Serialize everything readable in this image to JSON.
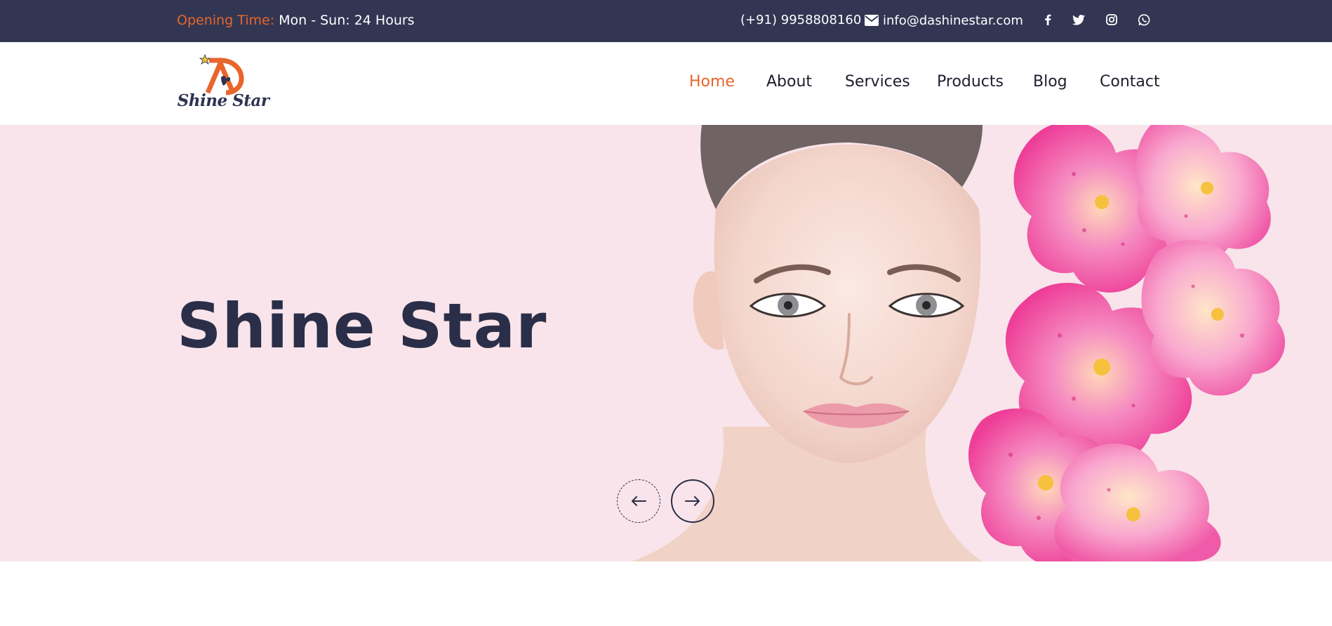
{
  "topbar": {
    "opening_label": "Opening Time:",
    "opening_value": "Mon - Sun: 24 Hours",
    "phone": "(+91) 9958808160",
    "email": "info@dashinestar.com",
    "icons": [
      "envelope-icon",
      "facebook-icon",
      "twitter-icon",
      "instagram-icon",
      "whatsapp-icon"
    ]
  },
  "header": {
    "logo_text": "Shine Star",
    "nav": [
      "Home",
      "About",
      "Services",
      "Products",
      "Blog",
      "Contact"
    ],
    "active_nav": "Home"
  },
  "hero": {
    "title": "Shine Star",
    "prev_icon": "arrow-left-icon",
    "next_icon": "arrow-right-icon"
  },
  "colors": {
    "topbar_bg": "#323653",
    "accent": "#e8652b",
    "hero_bg": "#f8e4ea",
    "navy": "#2b2e48"
  }
}
